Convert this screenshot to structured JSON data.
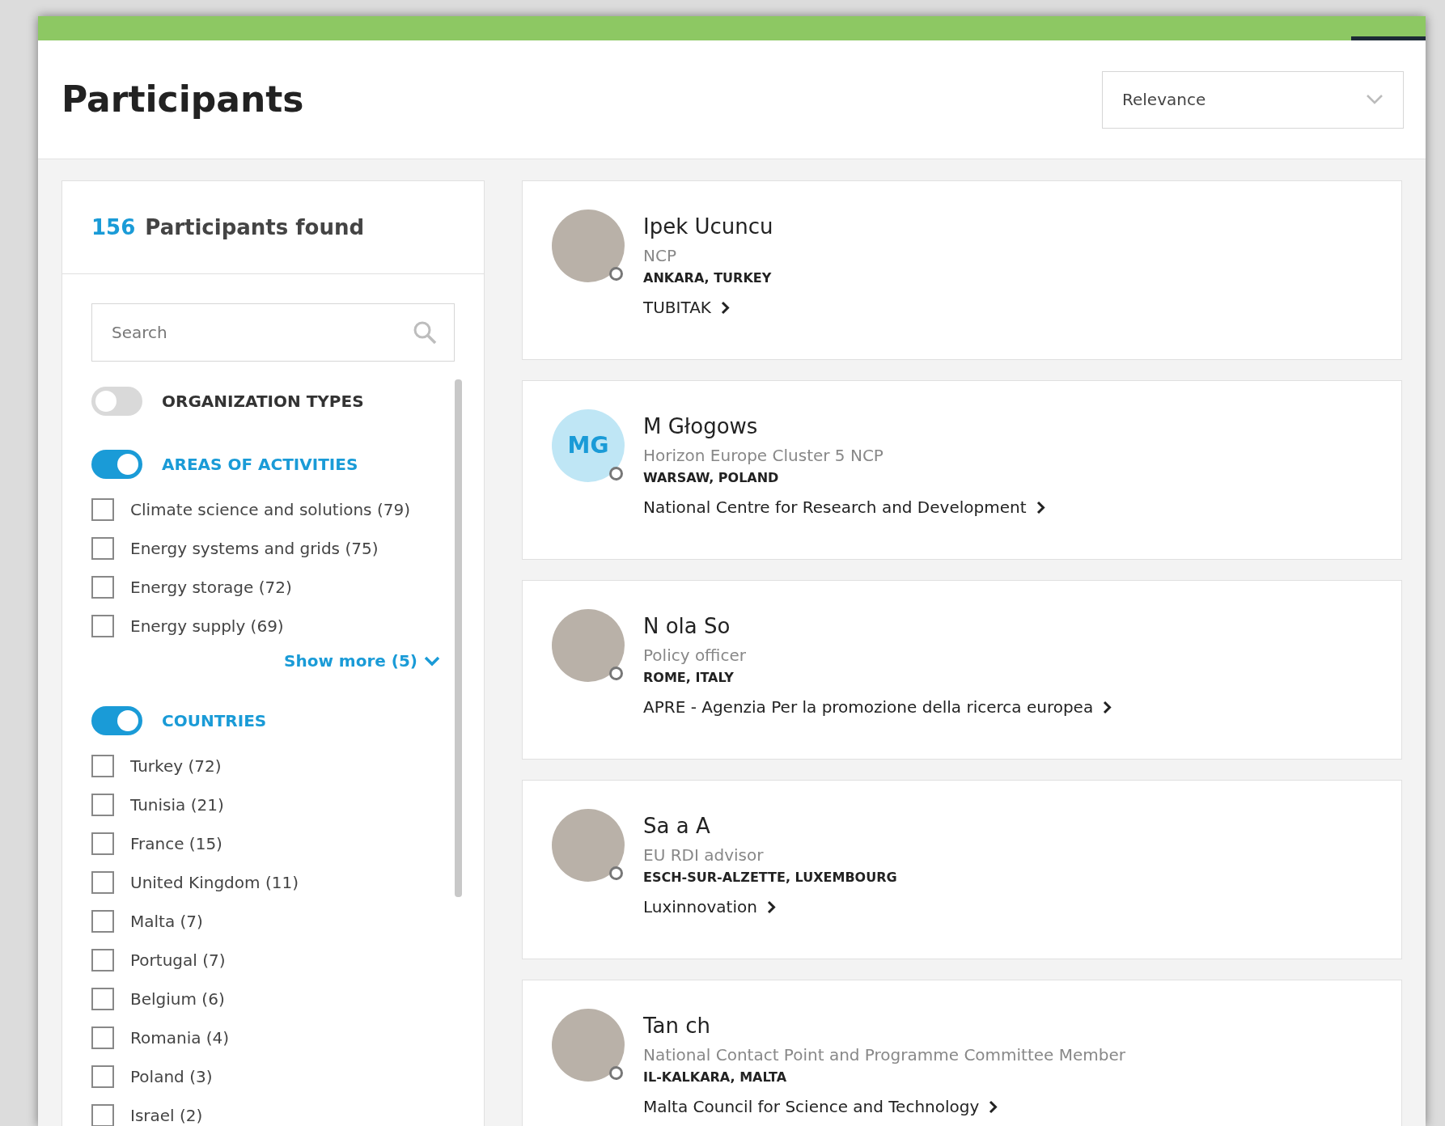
{
  "header": {
    "title": "Participants",
    "sort": {
      "value": "Relevance"
    }
  },
  "filters": {
    "count": "156",
    "count_label": "Participants found",
    "search": {
      "placeholder": "Search"
    },
    "groups": [
      {
        "label": "ORGANIZATION TYPES",
        "on": false
      },
      {
        "label": "AREAS OF ACTIVITIES",
        "on": true,
        "options": [
          {
            "label": "Climate science and solutions (79)",
            "checked": false
          },
          {
            "label": "Energy systems and grids (75)",
            "checked": false
          },
          {
            "label": "Energy storage (72)",
            "checked": false
          },
          {
            "label": "Energy supply (69)",
            "checked": false
          }
        ],
        "show_more": "Show more (5)"
      },
      {
        "label": "COUNTRIES",
        "on": true,
        "options": [
          {
            "label": "Turkey (72)",
            "checked": false
          },
          {
            "label": "Tunisia (21)",
            "checked": false
          },
          {
            "label": "France (15)",
            "checked": false
          },
          {
            "label": "United Kingdom (11)",
            "checked": false
          },
          {
            "label": "Malta (7)",
            "checked": false
          },
          {
            "label": "Portugal (7)",
            "checked": false
          },
          {
            "label": "Belgium (6)",
            "checked": false
          },
          {
            "label": "Romania (4)",
            "checked": false
          },
          {
            "label": "Poland (3)",
            "checked": false
          },
          {
            "label": "Israel (2)",
            "checked": false
          }
        ]
      }
    ]
  },
  "participants": [
    {
      "kind": "photo",
      "name": "Ipek Ucuncu",
      "role": "NCP",
      "location": "ANKARA, TURKEY",
      "organization": "TUBITAK"
    },
    {
      "kind": "initials",
      "initials": "MG",
      "name": "M Głogows",
      "role": "Horizon Europe Cluster 5 NCP",
      "location": "WARSAW, POLAND",
      "organization": "National Centre for Research and Development"
    },
    {
      "kind": "photo",
      "name": "N ola So",
      "role": "Policy officer",
      "location": "ROME, ITALY",
      "organization": "APRE - Agenzia Per la promozione della ricerca europea"
    },
    {
      "kind": "photo",
      "name": "Sa a A",
      "role": "EU RDI advisor",
      "location": "ESCH-SUR-ALZETTE, LUXEMBOURG",
      "organization": "Luxinnovation"
    },
    {
      "kind": "photo",
      "name": "Tan ch",
      "role": "National Contact Point and Programme Committee Member",
      "location": "IL-KALKARA, MALTA",
      "organization": "Malta Council for Science and Technology"
    }
  ]
}
